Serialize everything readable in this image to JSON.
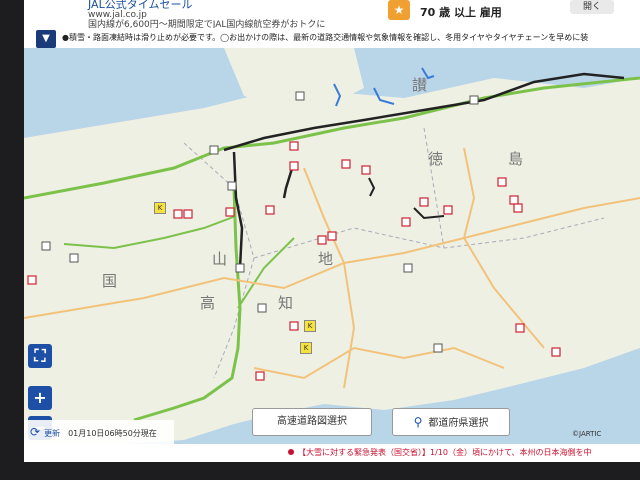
{
  "ad": {
    "left_title": "JAL公式タイムセール",
    "left_url": "www.jal.co.jp",
    "left_desc": "国内線が6,600円～期間限定でJAL国内線航空券がおトクに",
    "right_text": "70 歳 以上 雇用",
    "close_label": "開く"
  },
  "notice": {
    "toggle_icon": "chevron-down-icon",
    "text": "●積雪・路面凍結時は滑り止めが必要です。◯お出かけの際は、最新の道路交通情報や気象情報を確認し、冬用タイヤやタイヤチェーンを早めに装"
  },
  "map": {
    "labels": [
      "山",
      "高",
      "知",
      "地",
      "国",
      "徳",
      "島",
      "讃"
    ],
    "controls": {
      "fit_icon": "fullscreen-icon",
      "plus_label": "+",
      "minus_label": "−"
    }
  },
  "buttons": {
    "highway": "高速道路図選択",
    "prefecture": "都道府県選択"
  },
  "update": {
    "label": "更新",
    "time": "01月10日06時50分現在"
  },
  "credit": "©JARTIC",
  "ticker": "【大雪に対する緊急発表（国交省）】1/10（金）頃にかけて、本州の日本海側を中",
  "colors": {
    "accent": "#1e4fa6",
    "alert": "#c8102e",
    "route_green": "#7cc24a",
    "closure": "#cc2233"
  }
}
